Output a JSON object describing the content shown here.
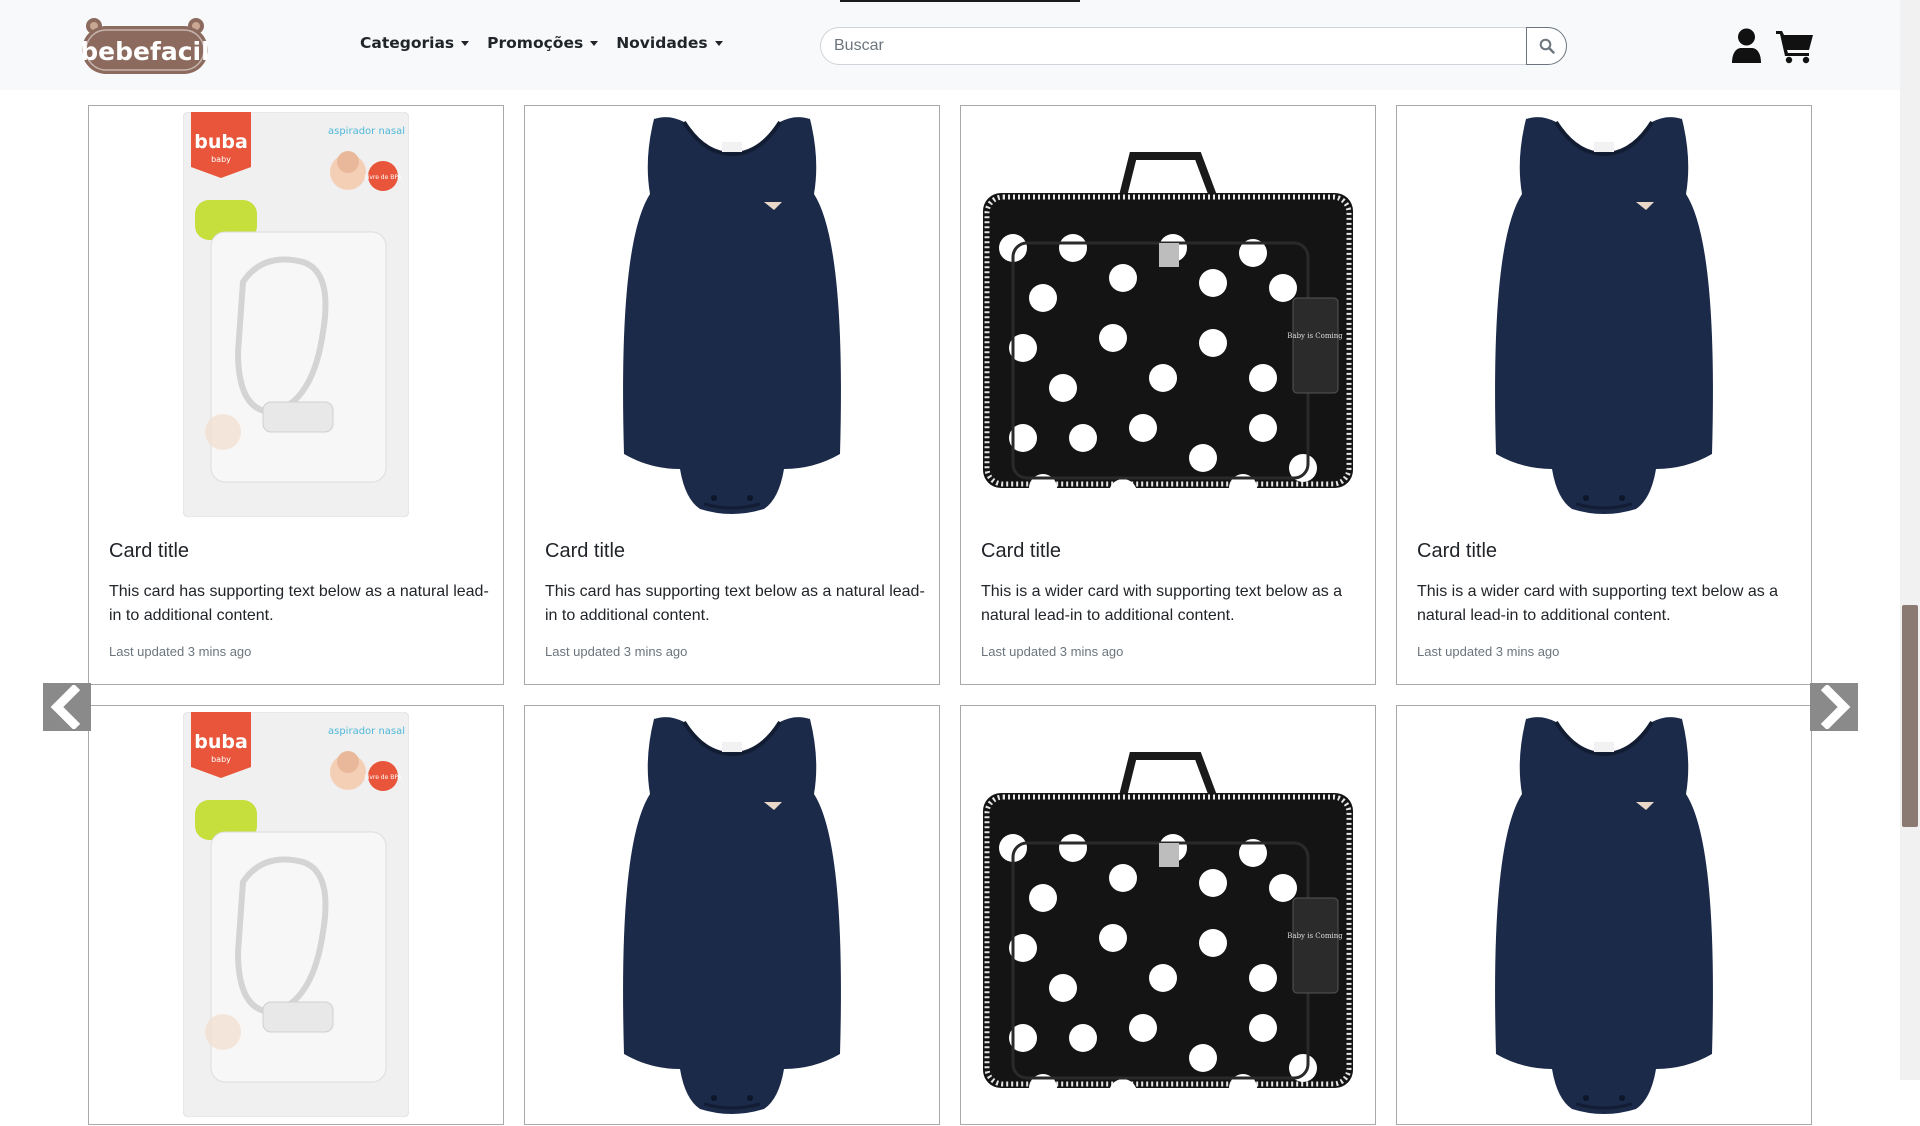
{
  "header": {
    "brand": "bebefacil",
    "nav": [
      {
        "label": "Categorias"
      },
      {
        "label": "Promoções"
      },
      {
        "label": "Novidades"
      }
    ],
    "search_placeholder": "Buscar"
  },
  "cards_row1": [
    {
      "product": "nasal-aspirator",
      "pack_brand": "buba",
      "pack_sub": "baby",
      "pack_text": "aspirador nasal com estojo",
      "pack_badge": "Livre de BPA",
      "title": "Card title",
      "text": "This card has supporting text below as a natural lead-in to additional content.",
      "footer": "Last updated 3 mins ago"
    },
    {
      "product": "navy-bodysuit",
      "title": "Card title",
      "text": "This card has supporting text below as a natural lead-in to additional content.",
      "footer": "Last updated 3 mins ago"
    },
    {
      "product": "polka-dot-bag",
      "tag_text": "Baby is Coming",
      "title": "Card title",
      "text": "This is a wider card with supporting text below as a natural lead-in to additional content.",
      "footer": "Last updated 3 mins ago"
    },
    {
      "product": "navy-bodysuit",
      "title": "Card title",
      "text": "This is a wider card with supporting text below as a natural lead-in to additional content.",
      "footer": "Last updated 3 mins ago"
    }
  ],
  "cards_row2": [
    {
      "product": "nasal-aspirator",
      "pack_brand": "buba",
      "pack_sub": "baby",
      "pack_text": "aspirador nasal com estojo",
      "pack_badge": "Livre de BPA"
    },
    {
      "product": "navy-bodysuit"
    },
    {
      "product": "polka-dot-bag",
      "tag_text": "Baby is Coming"
    },
    {
      "product": "navy-bodysuit"
    }
  ],
  "icons": {
    "prev": "chevron-left-icon",
    "next": "chevron-right-icon",
    "search": "search-icon",
    "user": "user-icon",
    "cart": "cart-icon"
  },
  "colors": {
    "navbar_bg": "#f8f9fa",
    "logo_brown": "#8c6a5d",
    "bodysuit_navy": "#1c2a4a",
    "scroll_thumb": "#8b7a71",
    "arrow_bg": "#8a8a8a"
  }
}
